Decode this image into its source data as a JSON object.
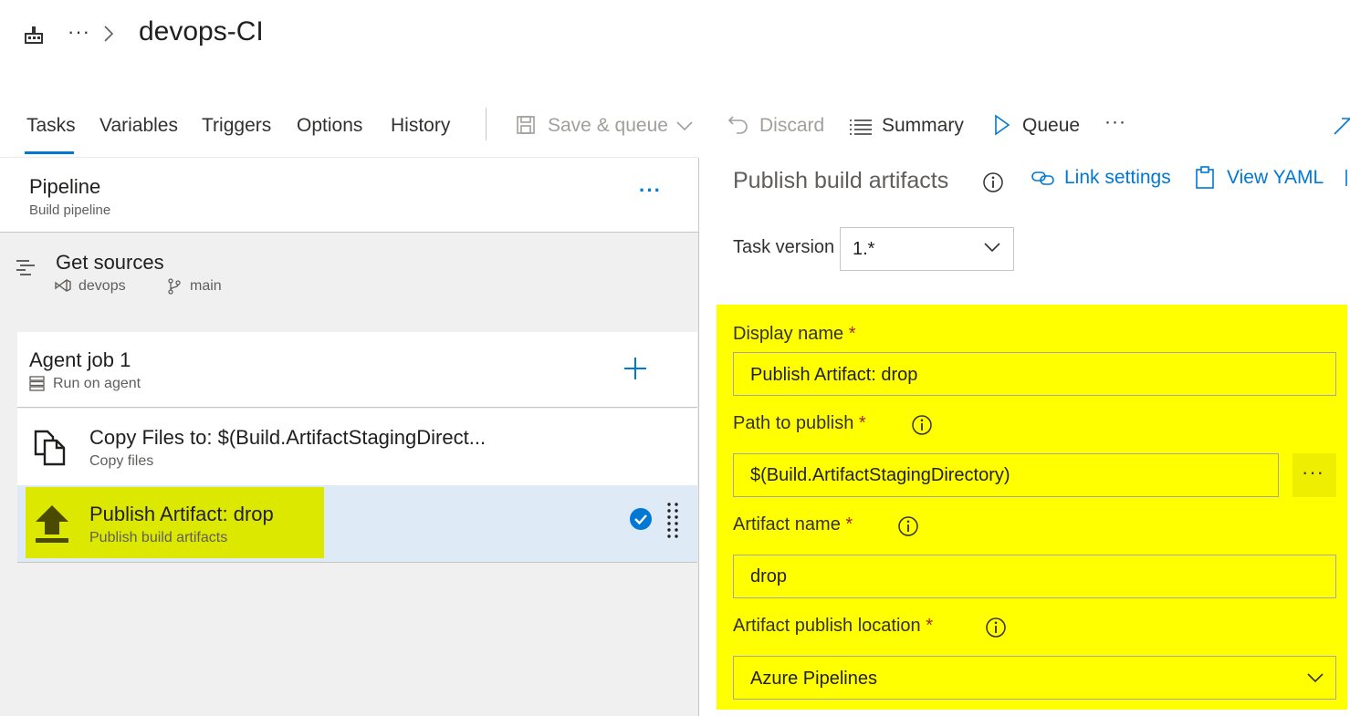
{
  "header": {
    "breadcrumb_more": "···",
    "title": "devops-CI"
  },
  "tabs": [
    {
      "label": "Tasks",
      "active": true
    },
    {
      "label": "Variables"
    },
    {
      "label": "Triggers"
    },
    {
      "label": "Options"
    },
    {
      "label": "History"
    }
  ],
  "toolbar": {
    "save_queue": "Save & queue",
    "discard": "Discard",
    "summary": "Summary",
    "queue": "Queue",
    "more": "···"
  },
  "pipeline": {
    "title": "Pipeline",
    "subtitle": "Build pipeline",
    "more": "···"
  },
  "get_sources": {
    "title": "Get sources",
    "repo": "devops",
    "branch": "main"
  },
  "agent_job": {
    "title": "Agent job 1",
    "subtitle": "Run on agent"
  },
  "tasks": [
    {
      "title": "Copy Files to: $(Build.ArtifactStagingDirect...",
      "subtitle": "Copy files",
      "selected": false
    },
    {
      "title": "Publish Artifact: drop",
      "subtitle": "Publish build artifacts",
      "selected": true
    }
  ],
  "detail": {
    "title": "Publish build artifacts",
    "link_settings": "Link settings",
    "view_yaml": "View YAML",
    "task_version_label": "Task version",
    "task_version_value": "1.*",
    "fields": {
      "display_name": {
        "label": "Display name",
        "required": "*",
        "value": "Publish Artifact: drop"
      },
      "path_to_publish": {
        "label": "Path to publish",
        "required": "*",
        "value": "$(Build.ArtifactStagingDirectory)",
        "browse": "···"
      },
      "artifact_name": {
        "label": "Artifact name",
        "required": "*",
        "value": "drop"
      },
      "publish_location": {
        "label": "Artifact publish location",
        "required": "*",
        "value": "Azure Pipelines"
      }
    }
  },
  "colors": {
    "accent": "#0078d4",
    "highlight_yellow": "#ffff00",
    "selected_task_highlight": "#dde800",
    "selected_row": "#dfeaf7"
  }
}
